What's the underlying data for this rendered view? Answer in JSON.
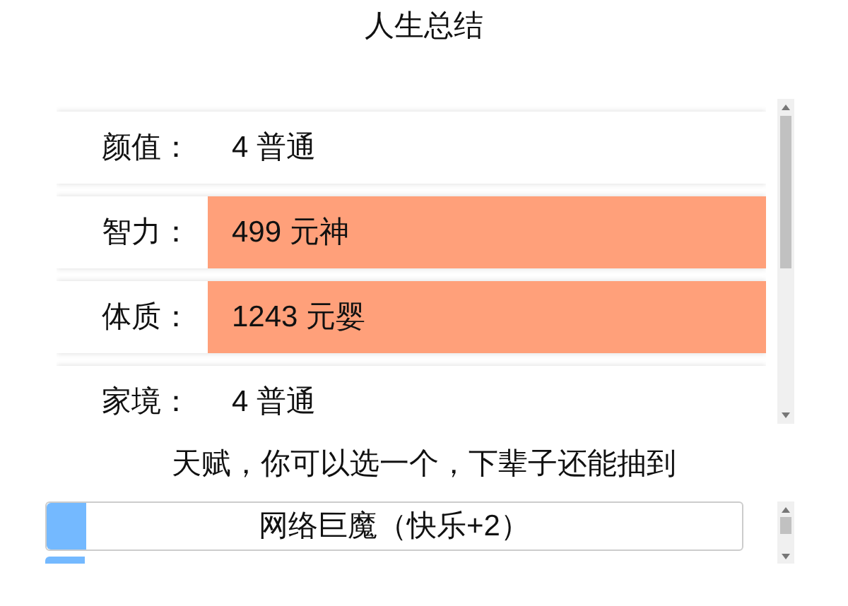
{
  "title": "人生总结",
  "stats": [
    {
      "label": "颜值：",
      "value": "4 普通",
      "highlighted": false
    },
    {
      "label": "智力：",
      "value": "499 元神",
      "highlighted": true
    },
    {
      "label": "体质：",
      "value": "1243 元婴",
      "highlighted": true
    },
    {
      "label": "家境：",
      "value": "4 普通",
      "highlighted": false
    }
  ],
  "talent_prompt": "天赋，你可以选一个，下辈子还能抽到",
  "talents": [
    {
      "label": "网络巨魔（快乐+2）"
    }
  ]
}
